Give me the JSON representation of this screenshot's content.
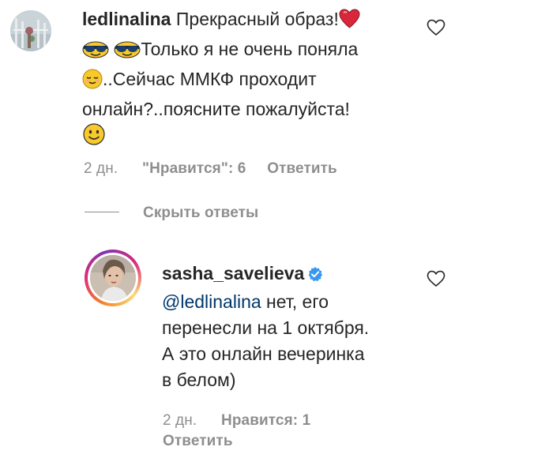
{
  "comment1": {
    "username": "ledlinalina",
    "text_line1": "Прекрасный образ!",
    "text_line2": "Только я не очень поняла",
    "text_line3": "..Сейчас ММКФ проходит",
    "text_line4": "онлайн?..поясните пожалуйста!",
    "time": "2 дн.",
    "likes": "\"Нравится\": 6",
    "reply": "Ответить"
  },
  "toggle_replies": {
    "label": "Скрыть ответы"
  },
  "reply1": {
    "username": "sasha_savelieva",
    "mention": "@ledlinalina",
    "text_line1": " нет, его",
    "text_line2": "перенесли на 1 октября.",
    "text_line3": "А это онлайн вечеринка",
    "text_line4": "в белом)",
    "time": "2 дн.",
    "likes": "Нравится: 1",
    "reply": "Ответить"
  },
  "icons": {
    "like": "heart-outline-icon",
    "verified": "verified-badge-icon",
    "emoji_heart": "red-heart-emoji",
    "emoji_sunglasses": "smiling-face-with-sunglasses-emoji",
    "emoji_relieved": "relieved-face-emoji",
    "emoji_smile": "slightly-smiling-face-emoji"
  },
  "colors": {
    "text": "#262626",
    "meta": "#8e8e8e",
    "mention": "#00376b",
    "verified": "#3897f0"
  }
}
